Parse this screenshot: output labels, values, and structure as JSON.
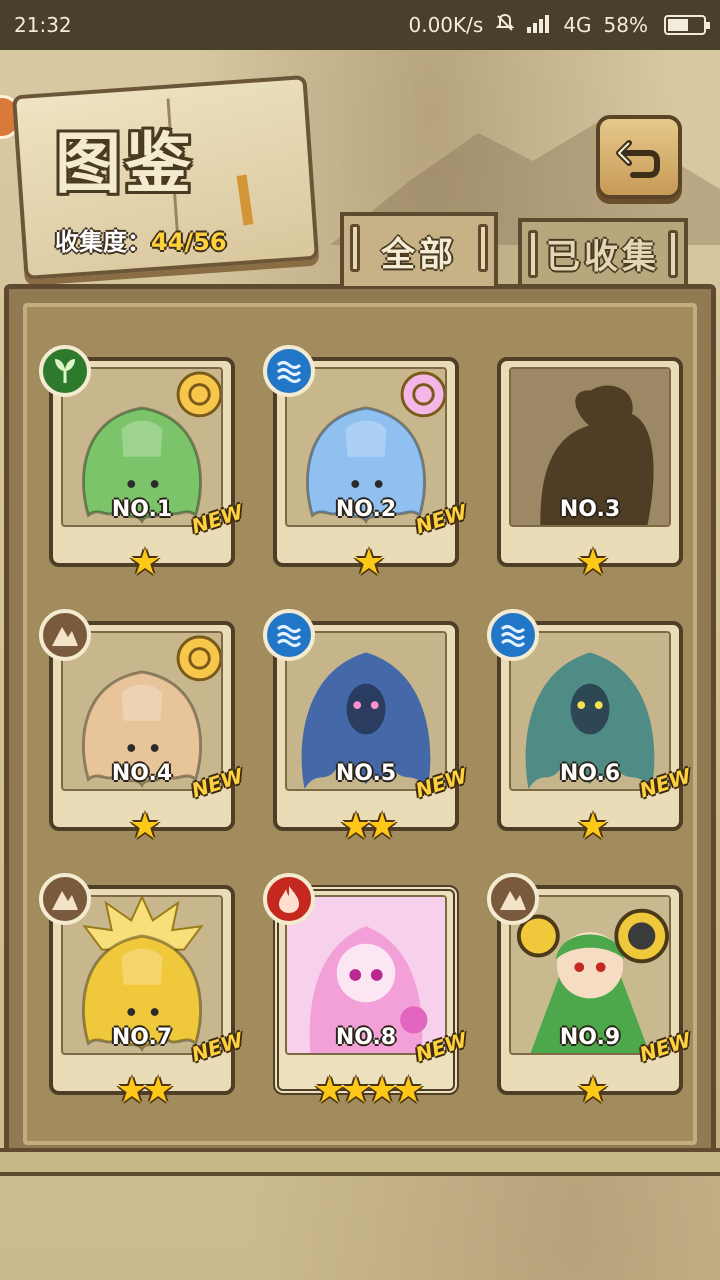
{
  "status_bar": {
    "time": "21:32",
    "network_speed": "0.00K/s",
    "network_type": "4G",
    "battery": "58%",
    "battery_level": 0.58,
    "icons": [
      "mute-bell-icon",
      "signal-icon",
      "battery-icon"
    ]
  },
  "header": {
    "title": "图鉴",
    "collection_label": "收集度：",
    "collection_value": "44/56"
  },
  "tabs": [
    {
      "label": "全部",
      "active": true
    },
    {
      "label": "已收集",
      "active": false
    }
  ],
  "cards": [
    {
      "no": "NO.1",
      "element": "grass",
      "stars": "★",
      "star_count": 1,
      "new": "NEW",
      "art": "green-slime",
      "color": "#7cc46a"
    },
    {
      "no": "NO.2",
      "element": "water",
      "stars": "★",
      "star_count": 1,
      "new": "NEW",
      "art": "blue-slime",
      "color": "#8fc0f0"
    },
    {
      "no": "NO.3",
      "element": "",
      "stars": "★",
      "star_count": 1,
      "new": "",
      "art": "silhouette",
      "color": "#4f3d25"
    },
    {
      "no": "NO.4",
      "element": "earth",
      "stars": "★",
      "star_count": 1,
      "new": "NEW",
      "art": "beige-slime",
      "color": "#e8c49a"
    },
    {
      "no": "NO.5",
      "element": "water",
      "stars": "★★",
      "star_count": 2,
      "new": "NEW",
      "art": "dark-blue-ghost",
      "color": "#4468a8"
    },
    {
      "no": "NO.6",
      "element": "water",
      "stars": "★",
      "star_count": 1,
      "new": "NEW",
      "art": "teal-ghost",
      "color": "#4f8c86"
    },
    {
      "no": "NO.7",
      "element": "earth",
      "stars": "★★",
      "star_count": 2,
      "new": "NEW",
      "art": "yellow-slime",
      "color": "#f0c83c"
    },
    {
      "no": "NO.8",
      "element": "fire",
      "stars": "★★★★",
      "star_count": 4,
      "new": "NEW",
      "art": "pink-girl",
      "color": "#f4a0d8"
    },
    {
      "no": "NO.9",
      "element": "earth",
      "stars": "★",
      "star_count": 1,
      "new": "NEW",
      "art": "green-girl",
      "color": "#4ca84a"
    }
  ]
}
